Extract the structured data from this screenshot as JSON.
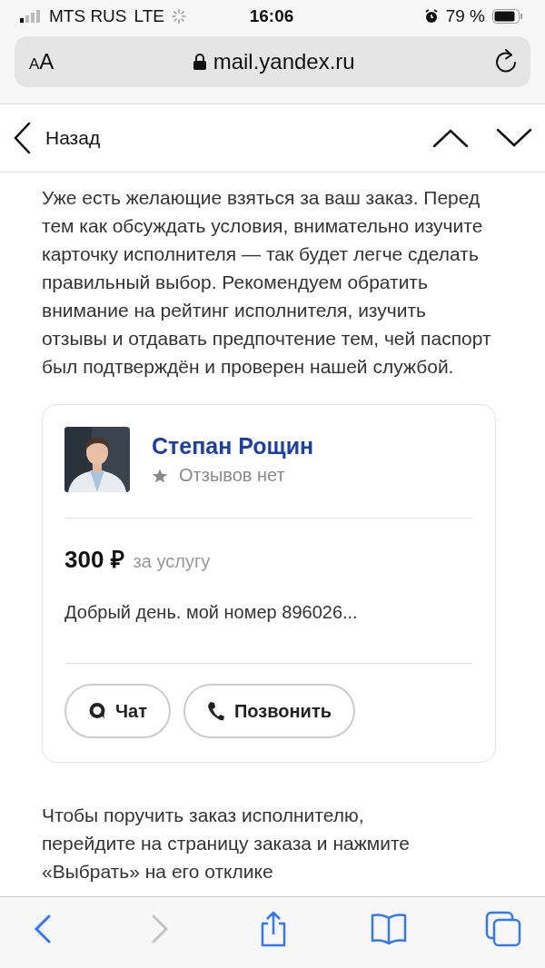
{
  "status_bar": {
    "carrier": "MTS RUS",
    "network": "LTE",
    "time": "16:06",
    "battery": "79 %"
  },
  "address_bar": {
    "text_size_letters": [
      "A",
      "A"
    ],
    "url": "mail.yandex.ru"
  },
  "nav_bar": {
    "back_label": "Назад"
  },
  "intro": "Уже есть желающие взяться за ваш заказ. Перед тем как обсуждать условия, внимательно изучите карточку исполнителя — так будет легче сделать правильный выбор. Рекомендуем обратить внимание на рейтинг исполнителя, изучить отзывы и отдавать предпочтение тем, чей паспорт был подтверждён и проверен нашей службой.",
  "card": {
    "name": "Степан Рощин",
    "reviews": "Отзывов нет",
    "price": "300 ₽",
    "price_unit": "за услугу",
    "message": "Добрый день. мой номер 896026...",
    "buttons": [
      {
        "kind": "chat",
        "label": "Чат"
      },
      {
        "kind": "call",
        "label": "Позвонить"
      }
    ]
  },
  "outro": "Чтобы поручить заказ исполнителю, перейдите на страницу заказа и нажмите «Выбрать» на его отклике",
  "toolbar": [
    {
      "kind": "back",
      "disabled": false
    },
    {
      "kind": "forward",
      "disabled": true
    },
    {
      "kind": "share",
      "disabled": false
    },
    {
      "kind": "bookmarks",
      "disabled": false
    },
    {
      "kind": "tabs",
      "disabled": false
    }
  ]
}
